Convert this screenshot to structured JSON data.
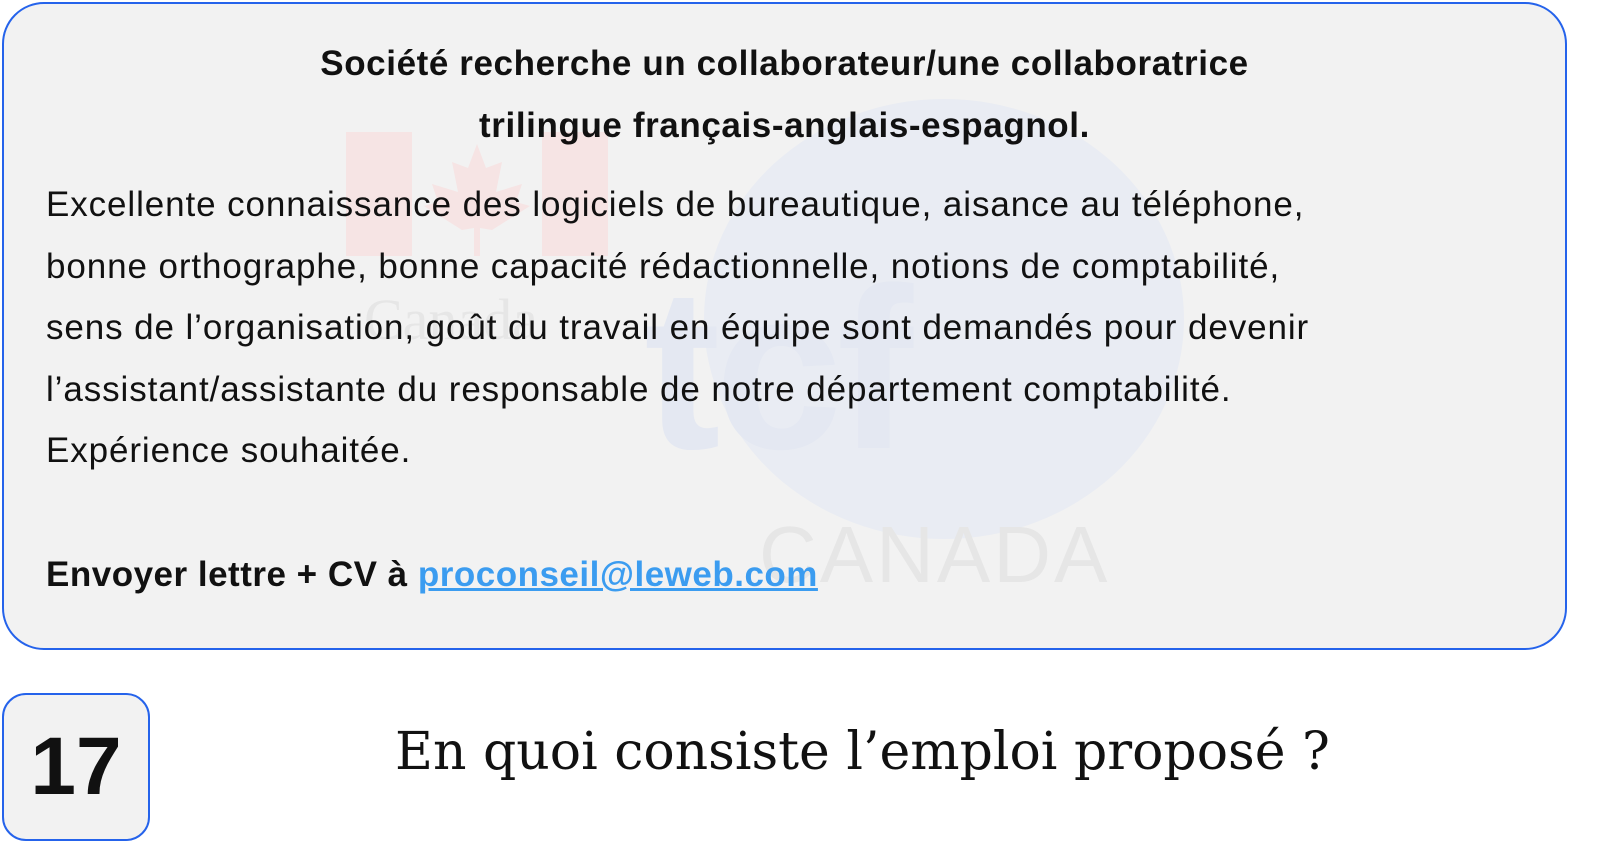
{
  "ad": {
    "title_lines": [
      "Société recherche un collaborateur/une collaboratrice",
      "trilingue français-anglais-espagnol."
    ],
    "body_lines": [
      "Excellente connaissance des logiciels de bureautique, aisance au téléphone,",
      "bonne orthographe, bonne capacité rédactionnelle, notions de comptabilité,",
      "sens de l’organisation, goût du travail en équipe sont demandés pour devenir",
      "l’assistant/assistante du responsable de notre département comptabilité.",
      "Expérience souhaitée."
    ],
    "contact_prefix": "Envoyer lettre + CV à ",
    "email": "proconseil@leweb.com"
  },
  "watermark": {
    "logo_text": "tcf",
    "logo_subtext": "CANADA",
    "gov_wordmark": "Canada"
  },
  "question": {
    "number": "17",
    "text": "En quoi consiste l’emploi proposé ?"
  },
  "colors": {
    "border": "#2563eb",
    "link": "#3b9cf0",
    "card_bg": "#f2f2f2"
  }
}
